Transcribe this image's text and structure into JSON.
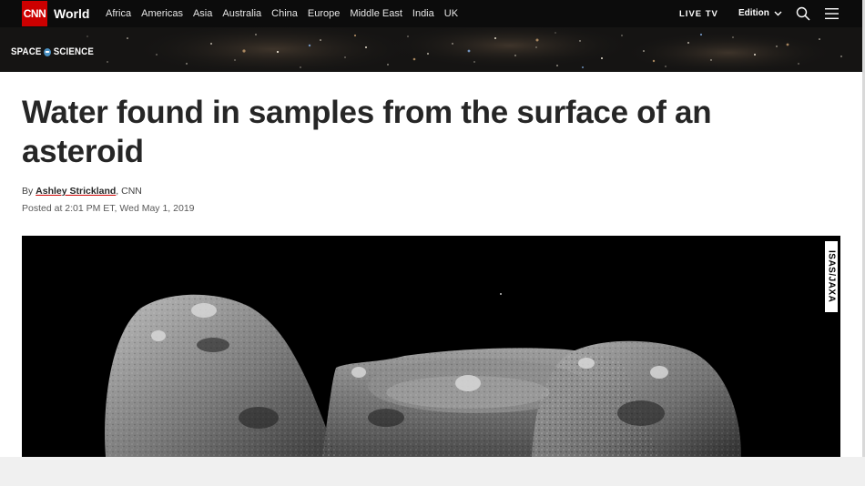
{
  "nav": {
    "logo": "CNN",
    "section": "World",
    "links": [
      "Africa",
      "Americas",
      "Asia",
      "Australia",
      "China",
      "Europe",
      "Middle East",
      "India",
      "UK"
    ],
    "live_tv": "LIVE TV",
    "edition": "Edition",
    "icons": [
      "search-icon",
      "menu-icon",
      "chevron-down-icon"
    ]
  },
  "banner": {
    "label_left": "SPACE",
    "label_right": "SCIENCE"
  },
  "article": {
    "headline": "Water found in samples from the surface of an asteroid",
    "byline_prefix": "By ",
    "author": "Ashley Strickland",
    "byline_suffix": ", CNN",
    "posted": "Posted at 2:01 PM ET, Wed May 1, 2019"
  },
  "image": {
    "credit": "ISAS/JAXA"
  },
  "colors": {
    "brand_red": "#cc0000",
    "nav_bg": "#0c0c0c",
    "headline": "#262626"
  }
}
